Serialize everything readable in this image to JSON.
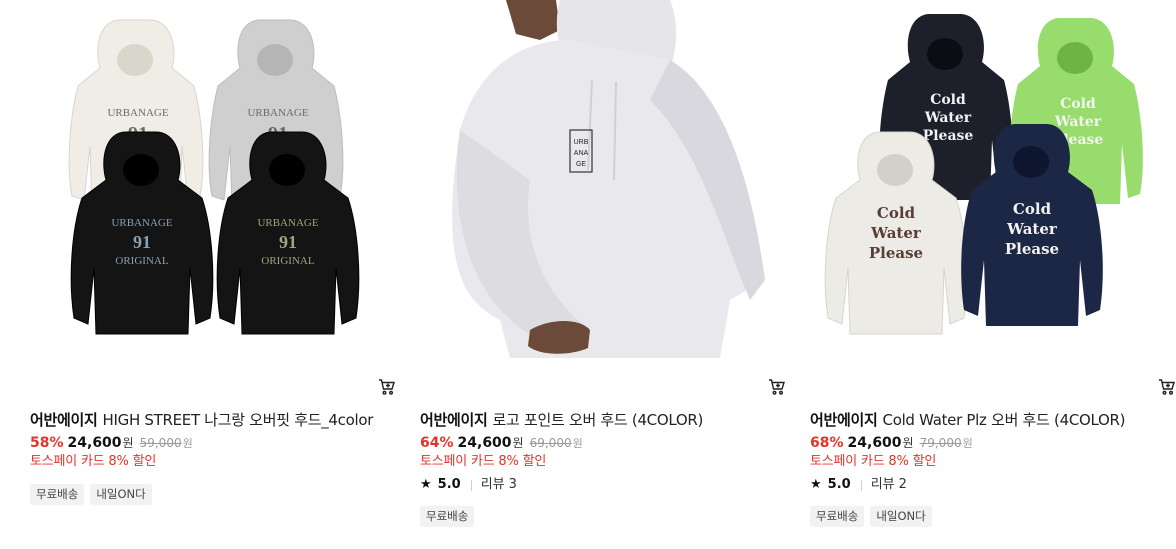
{
  "products": [
    {
      "brand": "어반에이지",
      "name": "HIGH STREET 나그랑 오버핏 후드_4color",
      "discount": "58%",
      "price": "24,600",
      "currency": "원",
      "original_price": "59,000",
      "original_currency": "원",
      "promo": "토스페이 카드 8% 할인",
      "tags": [
        "무료배송",
        "내일ON다"
      ],
      "print_text": [
        "URBANAGE",
        "91",
        "ORIGINAL"
      ],
      "image_icon": "hoodie-set-image"
    },
    {
      "brand": "어반에이지",
      "name": "로고 포인트 오버 후드 (4COLOR)",
      "discount": "64%",
      "price": "24,600",
      "currency": "원",
      "original_price": "69,000",
      "original_currency": "원",
      "promo": "토스페이 카드 8% 할인",
      "rating": "5.0",
      "review_label": "리뷰",
      "review_count": "3",
      "tags": [
        "무료배송"
      ],
      "print_text": [
        "URB",
        "ANA",
        "GE"
      ],
      "image_icon": "model-hoodie-image"
    },
    {
      "brand": "어반에이지",
      "name": "Cold Water Plz 오버 후드 (4COLOR)",
      "discount": "68%",
      "price": "24,600",
      "currency": "원",
      "original_price": "79,000",
      "original_currency": "원",
      "promo": "토스페이 카드 8% 할인",
      "rating": "5.0",
      "review_label": "리뷰",
      "review_count": "2",
      "tags": [
        "무료배송",
        "내일ON다"
      ],
      "print_text": [
        "Cold",
        "Water",
        "Please"
      ],
      "image_icon": "hoodie-set-image"
    }
  ],
  "icons": {
    "cart": "cart-add-icon",
    "star": "star-icon"
  },
  "colors": {
    "discount": "#e5332a",
    "promo": "#e5332a",
    "tag_bg": "#f2f2f2",
    "hoodie_green": "#98dc6e",
    "hoodie_navy": "#1c2645"
  }
}
